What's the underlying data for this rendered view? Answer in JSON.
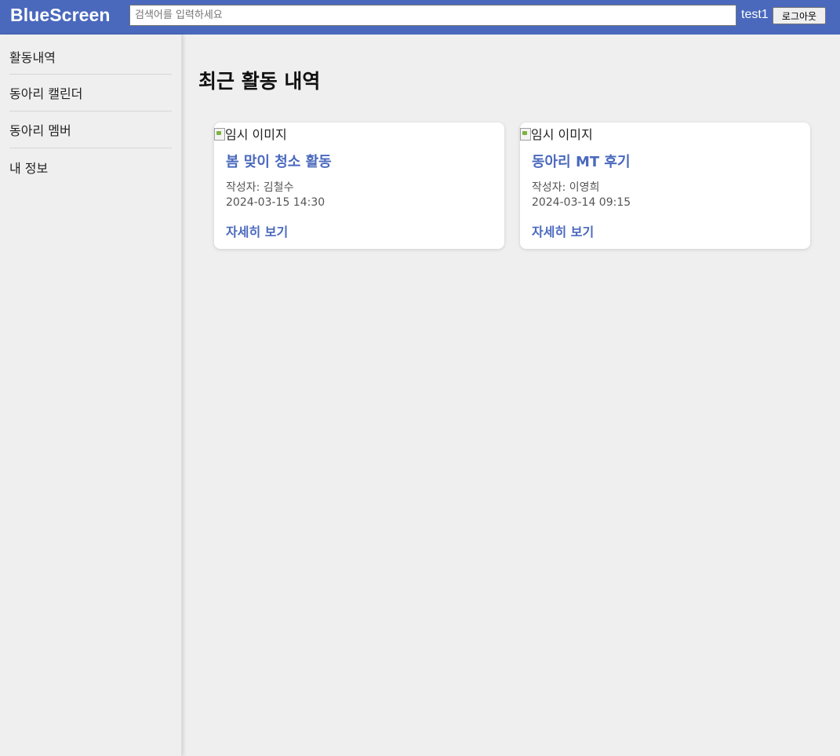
{
  "header": {
    "logo": "BlueScreen",
    "search_placeholder": "검색어를 입력하세요",
    "username": "test1",
    "logout_label": "로그아웃"
  },
  "sidebar": {
    "items": [
      {
        "label": "활동내역"
      },
      {
        "label": "동아리 캘린더"
      },
      {
        "label": "동아리 멤버"
      },
      {
        "label": "내 정보"
      }
    ]
  },
  "main": {
    "title": "최근 활동 내역",
    "cards": [
      {
        "image_alt": "임시 이미지",
        "title": "봄 맞이 청소 활동",
        "author": "작성자: 김철수",
        "date": "2024-03-15 14:30",
        "link_label": "자세히 보기"
      },
      {
        "image_alt": "임시 이미지",
        "title": "동아리 MT 후기",
        "author": "작성자: 이영희",
        "date": "2024-03-14 09:15",
        "link_label": "자세히 보기"
      }
    ]
  },
  "colors": {
    "header_bg": "#4a69bd",
    "accent": "#4a69bd",
    "page_bg": "#efefef",
    "card_bg": "#ffffff"
  }
}
